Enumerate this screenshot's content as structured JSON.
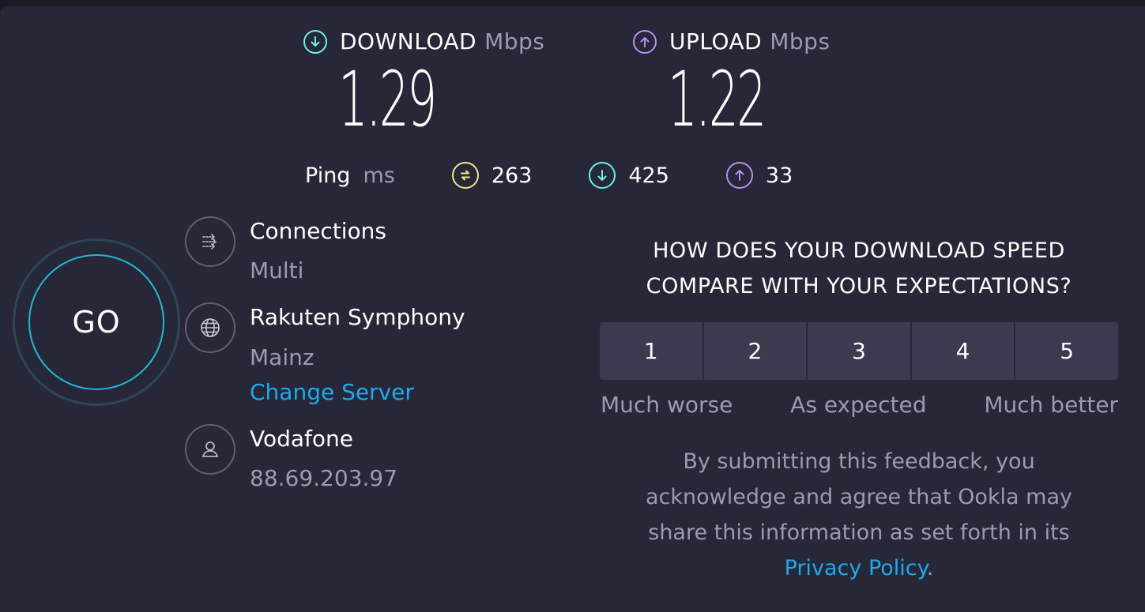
{
  "results": {
    "download": {
      "label": "DOWNLOAD",
      "unit": "Mbps",
      "value": "1.29",
      "icon": "arrow-down-circle-icon"
    },
    "upload": {
      "label": "UPLOAD",
      "unit": "Mbps",
      "value": "1.22",
      "icon": "arrow-up-circle-icon"
    }
  },
  "ping": {
    "label": "Ping",
    "unit": "ms",
    "idle": "263",
    "download": "425",
    "upload": "33"
  },
  "go_button": {
    "label": "GO"
  },
  "info": {
    "connections": {
      "title": "Connections",
      "value": "Multi"
    },
    "server": {
      "name": "Rakuten Symphony",
      "location": "Mainz",
      "change_link": "Change Server"
    },
    "provider": {
      "name": "Vodafone",
      "ip": "88.69.203.97"
    }
  },
  "feedback": {
    "question_line1": "HOW DOES YOUR DOWNLOAD SPEED",
    "question_line2": "COMPARE WITH YOUR EXPECTATIONS?",
    "ratings": [
      "1",
      "2",
      "3",
      "4",
      "5"
    ],
    "scale": {
      "low": "Much worse",
      "mid": "As expected",
      "high": "Much better"
    },
    "disclaimer_line1": "By submitting this feedback, you",
    "disclaimer_line2": "acknowledge and agree that Ookla may",
    "disclaimer_line3": "share this information as set forth in its",
    "privacy_link": "Privacy Policy",
    "privacy_suffix": "."
  },
  "colors": {
    "background": "#262737",
    "download_accent": "#6af2e4",
    "upload_accent": "#c08af4",
    "ping_accent": "#f5e58a",
    "link": "#1fa9ee",
    "go_ring": "#1fb8d6"
  }
}
